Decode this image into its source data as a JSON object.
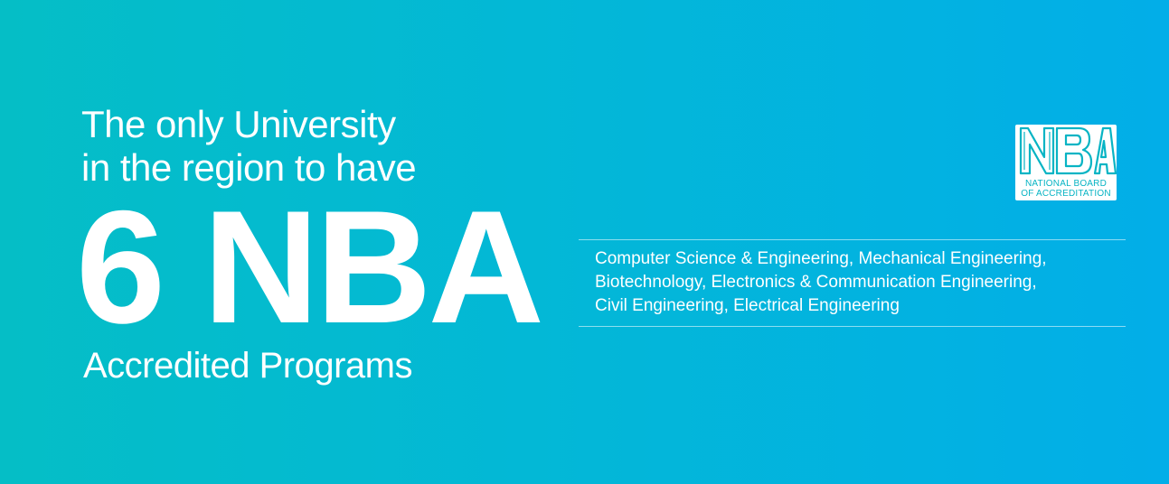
{
  "headline": {
    "line1": "The only University",
    "line2": "in the region to have"
  },
  "stat": "6 NBA",
  "subhead": "Accredited Programs",
  "programs": {
    "line1": "Computer Science & Engineering, Mechanical Engineering,",
    "line2": "Biotechnology, Electronics & Communication Engineering,",
    "line3": "Civil Engineering, Electrical Engineering"
  },
  "logo": {
    "mark": "NBA",
    "text_line1": "NATIONAL BOARD",
    "text_line2": "OF ACCREDITATION"
  },
  "colors": {
    "gradient_start": "#05bec6",
    "gradient_end": "#02aee8",
    "text": "#ffffff"
  }
}
